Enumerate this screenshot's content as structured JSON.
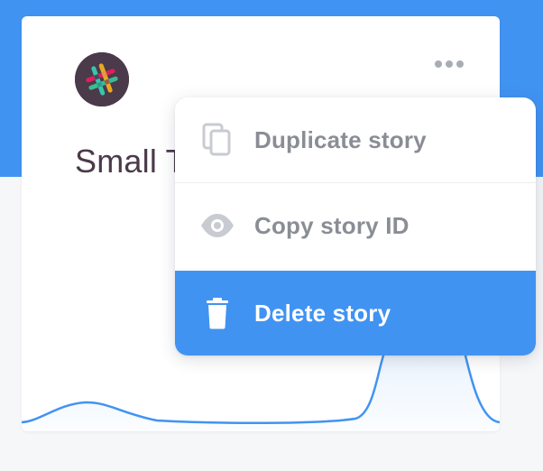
{
  "card": {
    "title": "Small T",
    "avatar_icon": "slack-logo-icon",
    "more_icon": "more-horizontal-icon"
  },
  "menu": {
    "items": [
      {
        "label": "Duplicate story",
        "icon": "copy-icon"
      },
      {
        "label": "Copy story ID",
        "icon": "eye-icon"
      },
      {
        "label": "Delete story",
        "icon": "trash-icon"
      }
    ]
  },
  "colors": {
    "accent": "#4193f2",
    "title_text": "#4a3a4a",
    "menu_text": "#8a8d94",
    "icon_gray": "#c8cbd1"
  }
}
